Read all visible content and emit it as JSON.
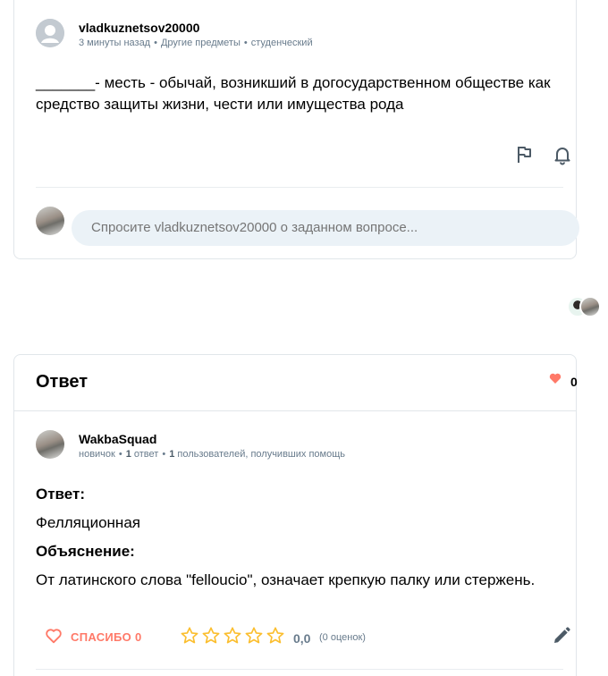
{
  "question": {
    "author": "vladkuznetsov20000",
    "time": "3 минуты назад",
    "subject": "Другие предметы",
    "level": "студенческий",
    "text": "_______- месть - обычай, возникший в догосударственном обществе как средство защиты жизни, чести или имущества рода",
    "ask_placeholder": "Спросите vladkuznetsov20000 о заданном вопросе..."
  },
  "answer": {
    "section_title": "Ответ",
    "likes": "0",
    "author": "WakbaSquad",
    "rank": "новичок",
    "answers_count": "1",
    "answers_label": "ответ",
    "helped_count": "1",
    "helped_label": "пользователей, получивших помощь",
    "answer_label": "Ответ:",
    "answer_text": "Фелляционная",
    "explanation_label": "Объяснение:",
    "explanation_text": "От латинского слова \"felloucio\", означает крепкую палку или стержень.",
    "thanks_label": "СПАСИБО 0",
    "rating_value": "0,0",
    "rating_count": "(0 оценок)"
  },
  "icons": {
    "report": "flag-icon",
    "follow": "bell-icon",
    "like": "heart-icon",
    "thanks": "heart-outline-icon",
    "star": "star-outline-icon",
    "edit": "pencil-icon"
  },
  "colors": {
    "accent_red": "#ff7968",
    "star_yellow": "#fbbe2e",
    "meta_gray": "#687b8c",
    "input_bg": "#ebf2f7"
  }
}
